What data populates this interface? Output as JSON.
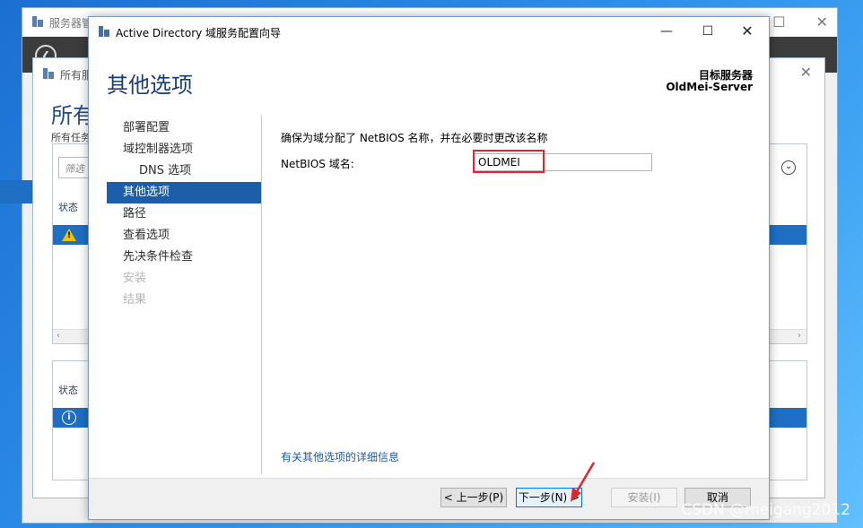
{
  "server_manager": {
    "title": "服务器管",
    "back_glyph": "❮"
  },
  "tasks_window": {
    "title": "所有服",
    "heading": "所有",
    "subheading": "所有任务",
    "filter_placeholder": "筛选",
    "col_status": "状态",
    "col_status_bottom": "状态"
  },
  "wizard": {
    "title": "Active Directory 域服务配置向导",
    "heading": "其他选项",
    "target_label": "目标服务器",
    "target_name": "OldMei-Server",
    "nav": [
      {
        "label": "部署配置",
        "state": "normal"
      },
      {
        "label": "域控制器选项",
        "state": "normal"
      },
      {
        "label": "DNS 选项",
        "state": "sub"
      },
      {
        "label": "其他选项",
        "state": "active"
      },
      {
        "label": "路径",
        "state": "normal"
      },
      {
        "label": "查看选项",
        "state": "normal"
      },
      {
        "label": "先决条件检查",
        "state": "normal"
      },
      {
        "label": "安装",
        "state": "disabled"
      },
      {
        "label": "结果",
        "state": "disabled"
      }
    ],
    "instruction": "确保为域分配了 NetBIOS 名称，并在必要时更改该名称",
    "netbios_label": "NetBIOS 域名:",
    "netbios_value": "OLDMEI",
    "more_link": "有关其他选项的详细信息",
    "buttons": {
      "prev": "< 上一步(P)",
      "next": "下一步(N) >",
      "install": "安装(I)",
      "cancel": "取消"
    }
  },
  "watermark": "CSDN @meigang2012",
  "colors": {
    "accent": "#1c5fa8",
    "highlight": "#e0262a",
    "link": "#1f5aa6"
  }
}
